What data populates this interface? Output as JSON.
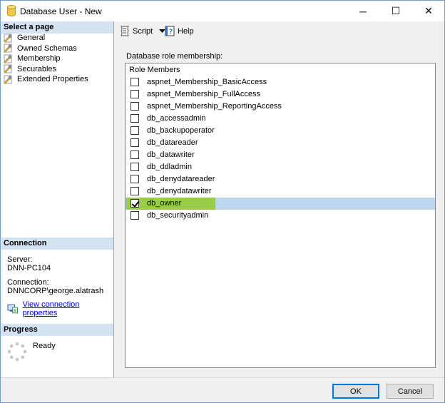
{
  "window": {
    "title": "Database User - New",
    "minimize_glyph": "─",
    "maximize_glyph": "☐",
    "close_glyph": "✕"
  },
  "sidebar": {
    "select_page_header": "Select a page",
    "pages": [
      {
        "label": "General",
        "icon": "wrench-page-icon"
      },
      {
        "label": "Owned Schemas",
        "icon": "wrench-page-icon"
      },
      {
        "label": "Membership",
        "icon": "wrench-page-icon"
      },
      {
        "label": "Securables",
        "icon": "wrench-page-icon"
      },
      {
        "label": "Extended Properties",
        "icon": "wrench-page-icon"
      }
    ],
    "connection_header": "Connection",
    "server_label": "Server:",
    "server_value": "DNN-PC104",
    "connection_label": "Connection:",
    "connection_value": "DNNCORP\\george.alatrash",
    "view_connection_link": "View connection properties",
    "progress_header": "Progress",
    "progress_status": "Ready"
  },
  "toolbar": {
    "script_label": "Script",
    "help_label": "Help"
  },
  "main": {
    "role_membership_label": "Database role membership:",
    "column_header": "Role Members",
    "roles": [
      {
        "name": "aspnet_Membership_BasicAccess",
        "checked": false
      },
      {
        "name": "aspnet_Membership_FullAccess",
        "checked": false
      },
      {
        "name": "aspnet_Membership_ReportingAccess",
        "checked": false
      },
      {
        "name": "db_accessadmin",
        "checked": false
      },
      {
        "name": "db_backupoperator",
        "checked": false
      },
      {
        "name": "db_datareader",
        "checked": false
      },
      {
        "name": "db_datawriter",
        "checked": false
      },
      {
        "name": "db_ddladmin",
        "checked": false
      },
      {
        "name": "db_denydatareader",
        "checked": false
      },
      {
        "name": "db_denydatawriter",
        "checked": false
      },
      {
        "name": "db_owner",
        "checked": true,
        "selected": true
      },
      {
        "name": "db_securityadmin",
        "checked": false
      }
    ]
  },
  "buttons": {
    "ok_label": "OK",
    "cancel_label": "Cancel"
  },
  "colors": {
    "section_header_bg": "#d3e3f1",
    "selected_row_bg": "#bcd6ee",
    "selected_cell_bg": "#9acd47",
    "link": "#0000ee"
  }
}
